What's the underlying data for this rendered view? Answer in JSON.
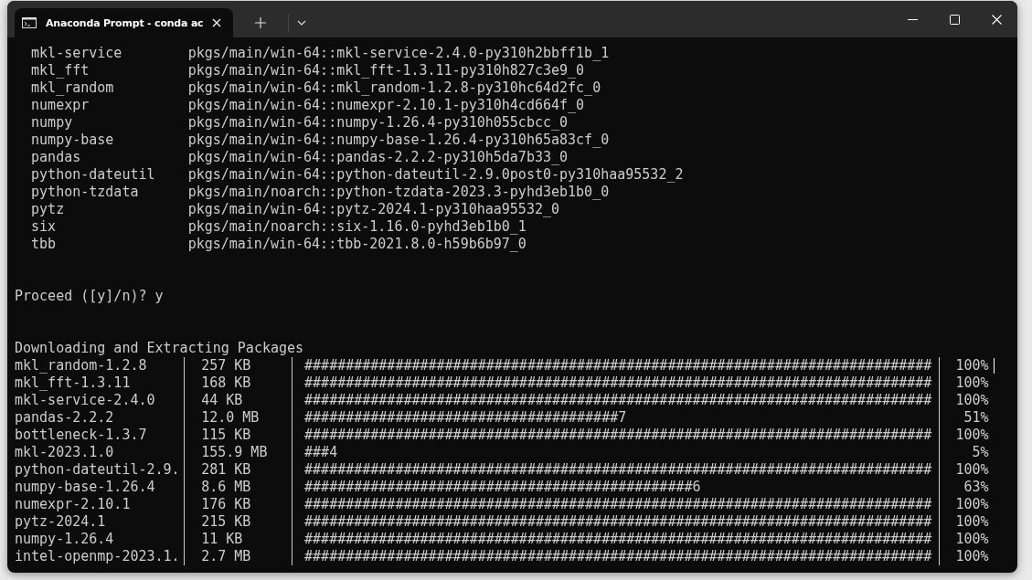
{
  "window": {
    "tab_title": "Anaconda Prompt - conda  ac"
  },
  "lines": [
    {
      "kind": "package",
      "name": "mkl-service",
      "source": "pkgs/main/win-64::mkl-service-2.4.0-py310h2bbff1b_1"
    },
    {
      "kind": "package",
      "name": "mkl_fft",
      "source": "pkgs/main/win-64::mkl_fft-1.3.11-py310h827c3e9_0"
    },
    {
      "kind": "package",
      "name": "mkl_random",
      "source": "pkgs/main/win-64::mkl_random-1.2.8-py310hc64d2fc_0"
    },
    {
      "kind": "package",
      "name": "numexpr",
      "source": "pkgs/main/win-64::numexpr-2.10.1-py310h4cd664f_0"
    },
    {
      "kind": "package",
      "name": "numpy",
      "source": "pkgs/main/win-64::numpy-1.26.4-py310h055cbcc_0"
    },
    {
      "kind": "package",
      "name": "numpy-base",
      "source": "pkgs/main/win-64::numpy-base-1.26.4-py310h65a83cf_0"
    },
    {
      "kind": "package",
      "name": "pandas",
      "source": "pkgs/main/win-64::pandas-2.2.2-py310h5da7b33_0"
    },
    {
      "kind": "package",
      "name": "python-dateutil",
      "source": "pkgs/main/win-64::python-dateutil-2.9.0post0-py310haa95532_2"
    },
    {
      "kind": "package",
      "name": "python-tzdata",
      "source": "pkgs/main/noarch::python-tzdata-2023.3-pyhd3eb1b0_0"
    },
    {
      "kind": "package",
      "name": "pytz",
      "source": "pkgs/main/win-64::pytz-2024.1-py310haa95532_0"
    },
    {
      "kind": "package",
      "name": "six",
      "source": "pkgs/main/noarch::six-1.16.0-pyhd3eb1b0_1"
    },
    {
      "kind": "package",
      "name": "tbb",
      "source": "pkgs/main/win-64::tbb-2021.8.0-h59b6b97_0"
    },
    {
      "kind": "blank"
    },
    {
      "kind": "blank"
    },
    {
      "kind": "prompt",
      "text": "Proceed ([y]/n)? y"
    },
    {
      "kind": "blank"
    },
    {
      "kind": "blank"
    },
    {
      "kind": "heading",
      "text": "Downloading and Extracting Packages"
    },
    {
      "kind": "download",
      "name": "mkl_random-1.2.8",
      "size": "257 KB",
      "bar": "############################################################################",
      "percent": "100%",
      "cursor": true
    },
    {
      "kind": "download",
      "name": "mkl_fft-1.3.11",
      "size": "168 KB",
      "bar": "############################################################################",
      "percent": "100%"
    },
    {
      "kind": "download",
      "name": "mkl-service-2.4.0",
      "size": "44 KB",
      "bar": "############################################################################",
      "percent": "100%"
    },
    {
      "kind": "download",
      "name": "pandas-2.2.2",
      "size": "12.0 MB",
      "bar": "######################################7",
      "percent": "51%"
    },
    {
      "kind": "download",
      "name": "bottleneck-1.3.7",
      "size": "115 KB",
      "bar": "############################################################################",
      "percent": "100%"
    },
    {
      "kind": "download",
      "name": "mkl-2023.1.0",
      "size": "155.9 MB",
      "bar": "###4",
      "percent": "5%"
    },
    {
      "kind": "download",
      "name": "python-dateutil-2.9.",
      "size": "281 KB",
      "bar": "############################################################################",
      "percent": "100%"
    },
    {
      "kind": "download",
      "name": "numpy-base-1.26.4",
      "size": "8.6 MB",
      "bar": "###############################################6",
      "percent": "63%"
    },
    {
      "kind": "download",
      "name": "numexpr-2.10.1",
      "size": "176 KB",
      "bar": "############################################################################",
      "percent": "100%"
    },
    {
      "kind": "download",
      "name": "pytz-2024.1",
      "size": "215 KB",
      "bar": "############################################################################",
      "percent": "100%"
    },
    {
      "kind": "download",
      "name": "numpy-1.26.4",
      "size": "11 KB",
      "bar": "############################################################################",
      "percent": "100%"
    },
    {
      "kind": "download",
      "name": "intel-openmp-2023.1.",
      "size": "2.7 MB",
      "bar": "############################################################################",
      "percent": "100%"
    }
  ]
}
